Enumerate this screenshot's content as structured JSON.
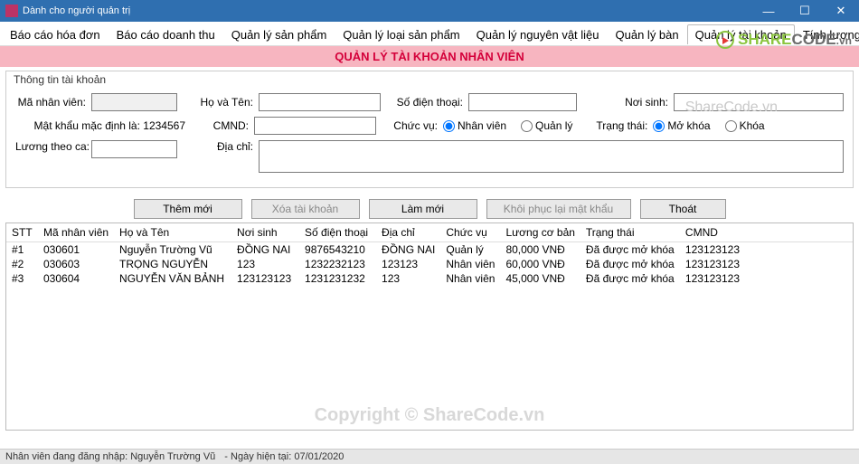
{
  "window": {
    "title": "Dành cho người quản trị"
  },
  "tabs": [
    {
      "label": "Báo cáo hóa đơn"
    },
    {
      "label": "Báo cáo doanh thu"
    },
    {
      "label": "Quản lý sản phẩm"
    },
    {
      "label": "Quản lý loại sản phẩm"
    },
    {
      "label": "Quản lý nguyên vật liệu"
    },
    {
      "label": "Quản lý bàn"
    },
    {
      "label": "Quản lý tài khoản",
      "active": true
    },
    {
      "label": "Tính lương t"
    }
  ],
  "banner": {
    "title": "QUẢN LÝ TÀI KHOẢN NHÂN VIÊN"
  },
  "group": {
    "legend": "Thông tin tài khoản"
  },
  "form": {
    "labels": {
      "ma_nhan_vien": "Mã nhân viên:",
      "ho_va_ten": "Họ và Tên:",
      "so_dien_thoai": "Số điện thoại:",
      "noi_sinh": "Nơi sinh:",
      "mat_khau_mac_dinh": "Mật khẩu mặc định là: 1234567",
      "cmnd": "CMND:",
      "chuc_vu": "Chức vụ:",
      "trang_thai": "Trạng thái:",
      "luong_theo_ca": "Lương theo ca:",
      "dia_chi": "Địa chỉ:"
    },
    "radios": {
      "chuc_vu_nhan_vien": "Nhân viên",
      "chuc_vu_quan_ly": "Quản lý",
      "tt_mo_khoa": "Mở khóa",
      "tt_khoa": "Khóa"
    },
    "values": {
      "ma_nhan_vien": "",
      "ho_va_ten": "",
      "so_dien_thoai": "",
      "noi_sinh": "",
      "cmnd": "",
      "luong_theo_ca": "",
      "dia_chi": ""
    }
  },
  "buttons": {
    "them_moi": "Thêm mới",
    "xoa_tai_khoan": "Xóa tài khoản",
    "lam_moi": "Làm mới",
    "khoi_phuc_mk": "Khôi phục lại mật khẩu",
    "thoat": "Thoát"
  },
  "table": {
    "headers": {
      "stt": "STT",
      "ma_nhan_vien": "Mã nhân viên",
      "ho_va_ten": "Họ và Tên",
      "noi_sinh": "Nơi sinh",
      "so_dien_thoai": "Số điện thoại",
      "dia_chi": "Địa chỉ",
      "chuc_vu": "Chức vụ",
      "luong_co_ban": "Lương cơ bản",
      "trang_thai": "Trạng thái",
      "cmnd": "CMND"
    },
    "rows": [
      {
        "stt": "#1",
        "ma": "030601",
        "ten": "Nguyễn Trường Vũ",
        "noi": "ĐỒNG NAI",
        "sdt": "9876543210",
        "dc": "ĐỒNG NAI",
        "cv": "Quản lý",
        "luong": "80,000 VNĐ",
        "tt": "Đã được mở khóa",
        "cmnd": "123123123"
      },
      {
        "stt": "#2",
        "ma": "030603",
        "ten": "TRỌNG NGUYỄN",
        "noi": "123",
        "sdt": "1232232123",
        "dc": "123123",
        "cv": "Nhân viên",
        "luong": "60,000 VNĐ",
        "tt": "Đã được mở khóa",
        "cmnd": "123123123"
      },
      {
        "stt": "#3",
        "ma": "030604",
        "ten": "NGUYỄN VĂN BẢNH",
        "noi": "123123123",
        "sdt": "1231231232",
        "dc": "123",
        "cv": "Nhân viên",
        "luong": "45,000 VNĐ",
        "tt": "Đã được mở khóa",
        "cmnd": "123123123"
      }
    ]
  },
  "status": {
    "logged_in": "Nhân viên đang đăng nhập: Nguyễn Trường Vũ",
    "today": "- Ngày hiện tại: 07/01/2020"
  },
  "watermark": {
    "copyright": "Copyright © ShareCode.vn",
    "brand_pre": "SHARE",
    "brand_post": "CODE",
    "brand_suffix": ".vn",
    "small": "ShareCode.vn"
  }
}
